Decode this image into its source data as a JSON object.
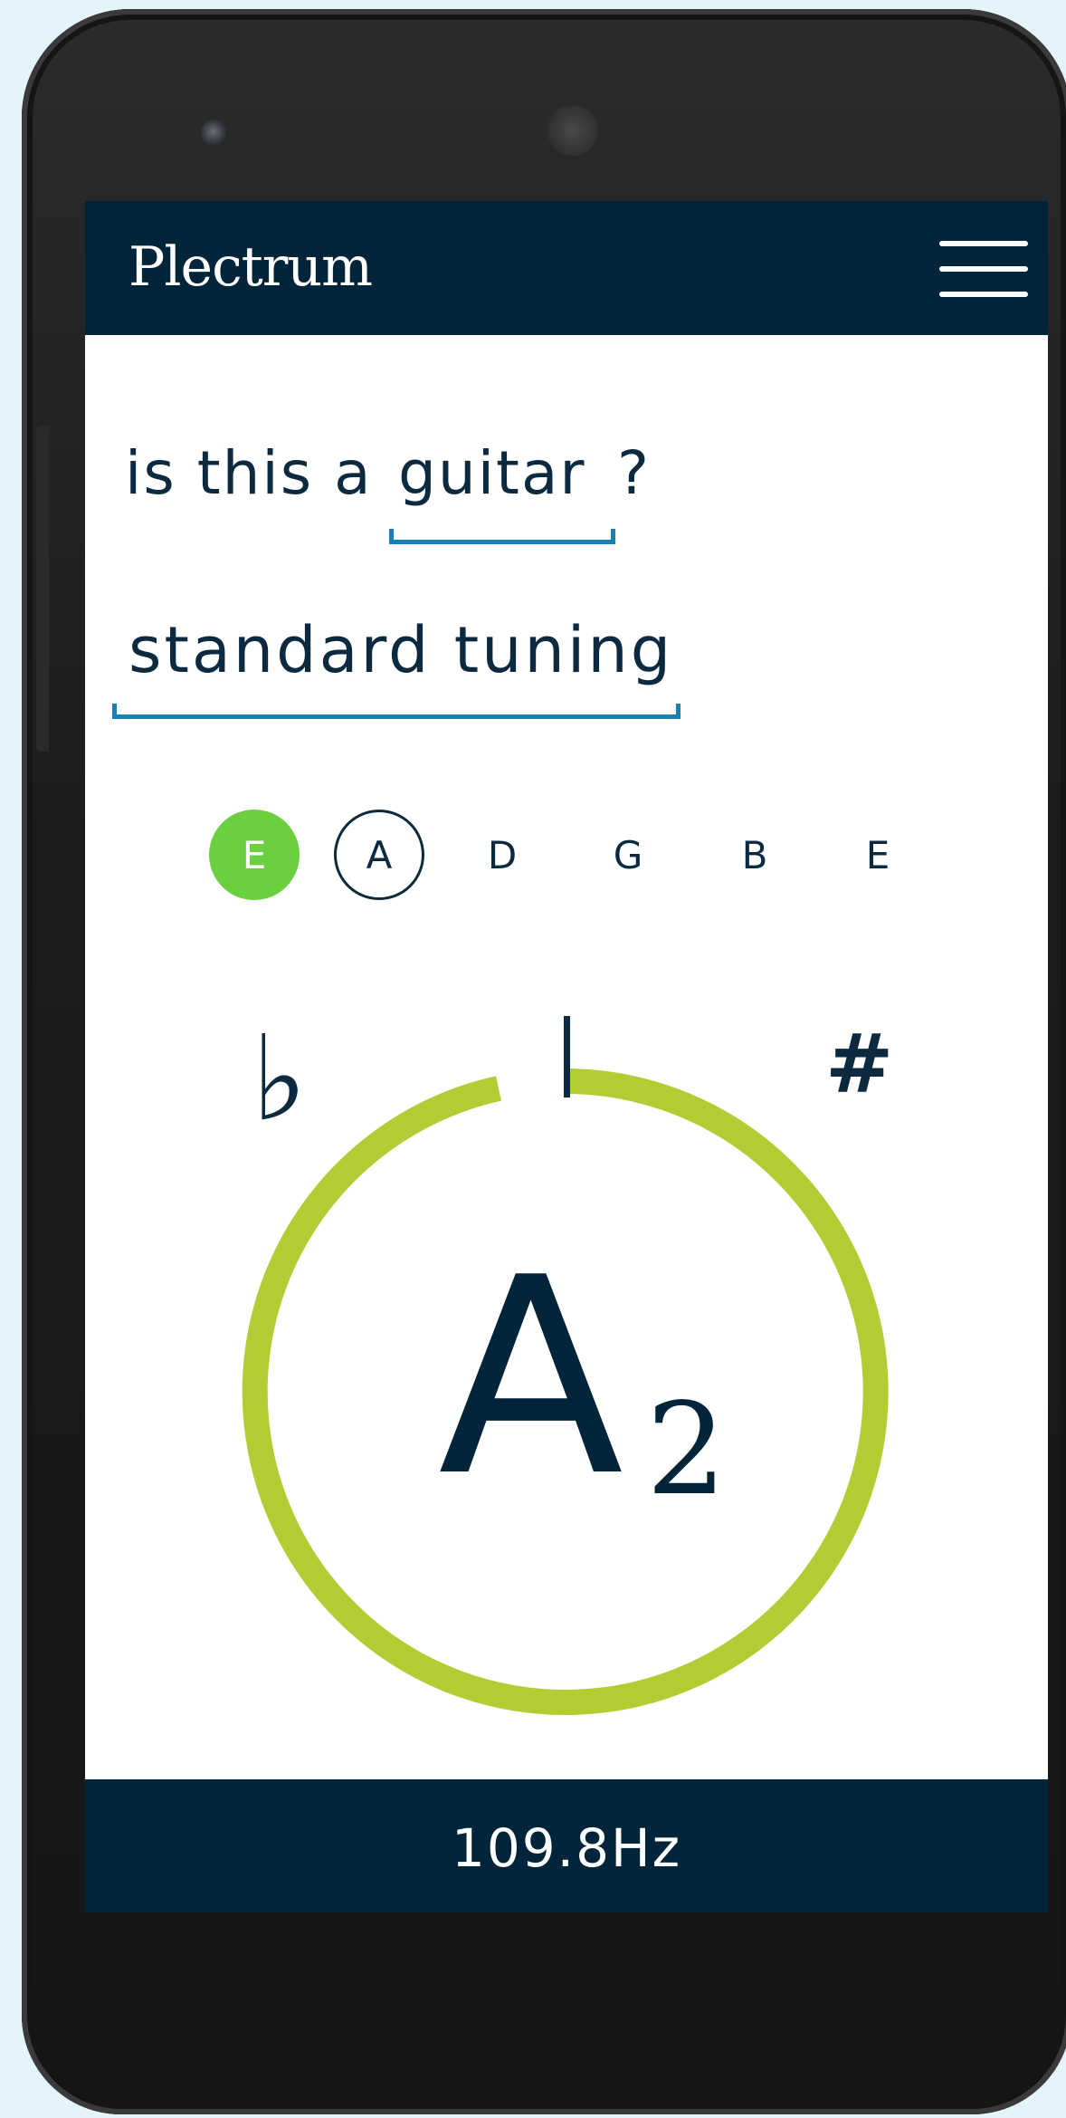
{
  "app": {
    "title": "Plectrum"
  },
  "instrument": {
    "prefix": "is this a",
    "selected": "guitar",
    "suffix": "?"
  },
  "tuning": {
    "selected": "standard tuning"
  },
  "strings": [
    {
      "label": "E",
      "state": "done"
    },
    {
      "label": "A",
      "state": "current"
    },
    {
      "label": "D",
      "state": "pending"
    },
    {
      "label": "G",
      "state": "pending"
    },
    {
      "label": "B",
      "state": "pending"
    },
    {
      "label": "E",
      "state": "pending"
    }
  ],
  "tuner": {
    "flat_symbol": "♭",
    "sharp_symbol": "#",
    "note_letter": "A",
    "note_octave": "2",
    "ring_color": "#b4cc34"
  },
  "footer": {
    "frequency": "109.8Hz"
  },
  "colors": {
    "navy": "#00243a",
    "accent_blue": "#1a7fb6",
    "done_green": "#6ccf3f",
    "ring_green": "#b4cc34"
  },
  "icons": {
    "menu": "hamburger-menu-icon"
  }
}
